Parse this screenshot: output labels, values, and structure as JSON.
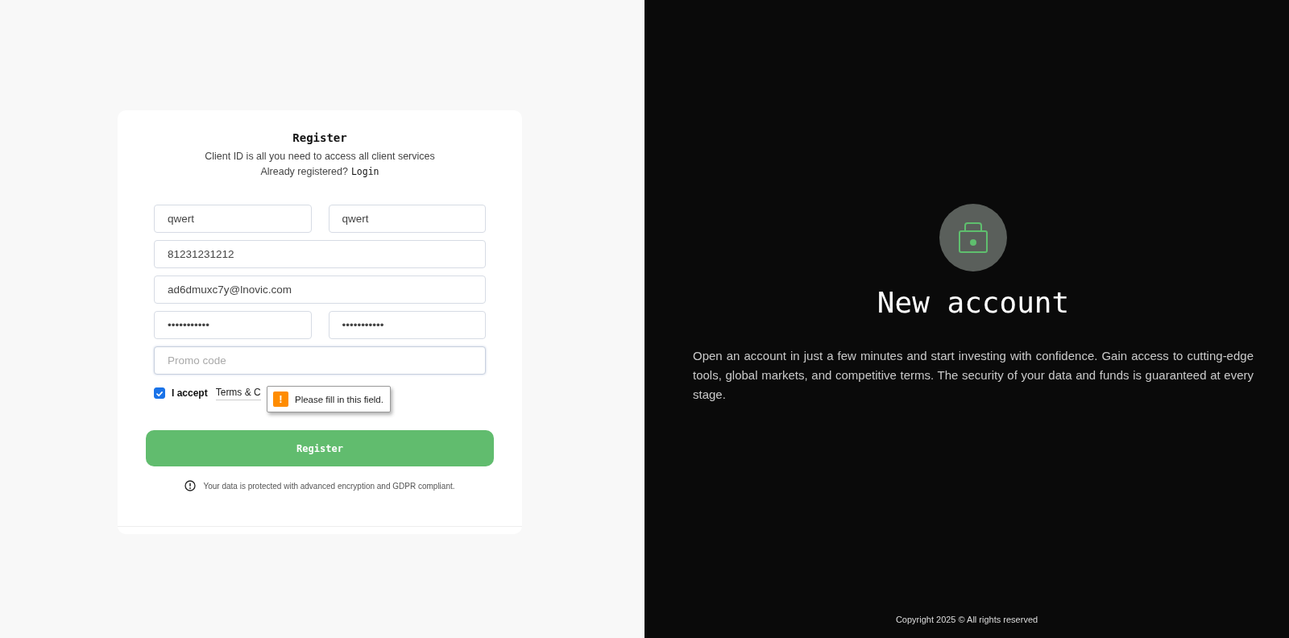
{
  "register_card": {
    "title": "Register",
    "subtitle": "Client ID is all you need to access all client services",
    "login_prompt": "Already registered?",
    "login_link": "Login",
    "fields": [
      {
        "items": [
          {
            "value": "qwert"
          },
          {
            "value": "qwert"
          }
        ]
      },
      {
        "items": [
          {
            "value": "81231231212"
          }
        ]
      },
      {
        "items": [
          {
            "value": "ad6dmuxc7y@lnovic.com"
          }
        ]
      },
      {
        "items": [
          {
            "value": "•••••••••••"
          },
          {
            "value": "•••••••••••"
          }
        ]
      },
      {
        "items": [
          {
            "placeholder": "Promo code",
            "focused": true
          }
        ]
      }
    ],
    "accept": {
      "label": "I accept",
      "checked": true,
      "link": "Terms & C"
    },
    "tooltip": {
      "text": "Please fill in this field.",
      "icon": "!"
    },
    "submit": "Register",
    "note": "Your data is protected with advanced encryption and GDPR compliant."
  },
  "hero": {
    "title": "New account",
    "text": "Open an account in just a few minutes and start investing with confidence. Gain access to cutting-edge tools, global markets, and competitive terms. The security of your data and funds is guaranteed at every stage.",
    "footer": "Copyright 2025 © All rights reserved"
  }
}
